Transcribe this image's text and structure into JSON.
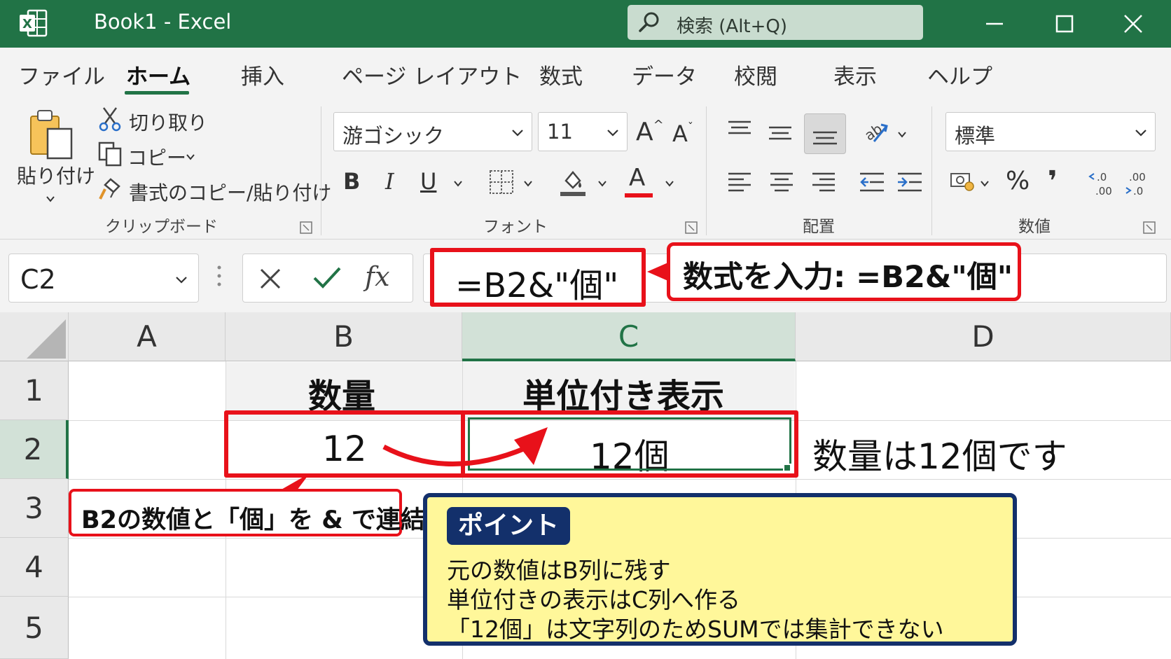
{
  "titlebar": {
    "title": "Book1  -  Excel",
    "search_placeholder": "検索 (Alt+Q)",
    "bg_color": "#217346"
  },
  "tabs": [
    "ファイル",
    "ホーム",
    "挿入",
    "ページ レイアウト",
    "数式",
    "データ",
    "校閲",
    "表示",
    "ヘルプ"
  ],
  "active_tab": "ホーム",
  "clipboard": {
    "paste": "貼り付け",
    "cut": "切り取り",
    "copy": "コピー",
    "format_painter": "書式のコピー/貼り付け",
    "group_label": "クリップボード"
  },
  "font": {
    "name": "游ゴシック",
    "size": "11",
    "bold": "B",
    "italic": "I",
    "underline": "U",
    "font_color_glyph": "A",
    "grow_glyph": "A",
    "shrink_glyph": "A",
    "group_label": "フォント",
    "font_color": "#e8111a"
  },
  "alignment": {
    "group_label": "配置"
  },
  "number": {
    "format": "標準",
    "percent": "%",
    "comma": "❜",
    "group_label": "数値"
  },
  "formula_bar": {
    "name_box": "C2",
    "fx": "fx",
    "formula": "=B2&\"個\"",
    "callout": "数式を入力: =B2&\"個\""
  },
  "sheet": {
    "columns": [
      "A",
      "B",
      "C",
      "D"
    ],
    "rows": [
      "1",
      "2",
      "3",
      "4",
      "5"
    ],
    "selected_cell": "C2",
    "cells": {
      "B1": "数量",
      "C1": "単位付き表示",
      "B2": "12",
      "C2": "12個",
      "D2": "数量は12個です"
    }
  },
  "callout_b2": "B2の数値と「個」を & で連結",
  "point": {
    "badge": "ポイント",
    "lines": [
      "元の数値はB列に残す",
      "単位付きの表示はC列へ作る",
      "「12個」は文字列のためSUMでは集計できない"
    ]
  },
  "colors": {
    "highlight": "#e8111a",
    "point_bg": "#fff79a",
    "point_border": "#13306b",
    "excel_green": "#217346"
  }
}
